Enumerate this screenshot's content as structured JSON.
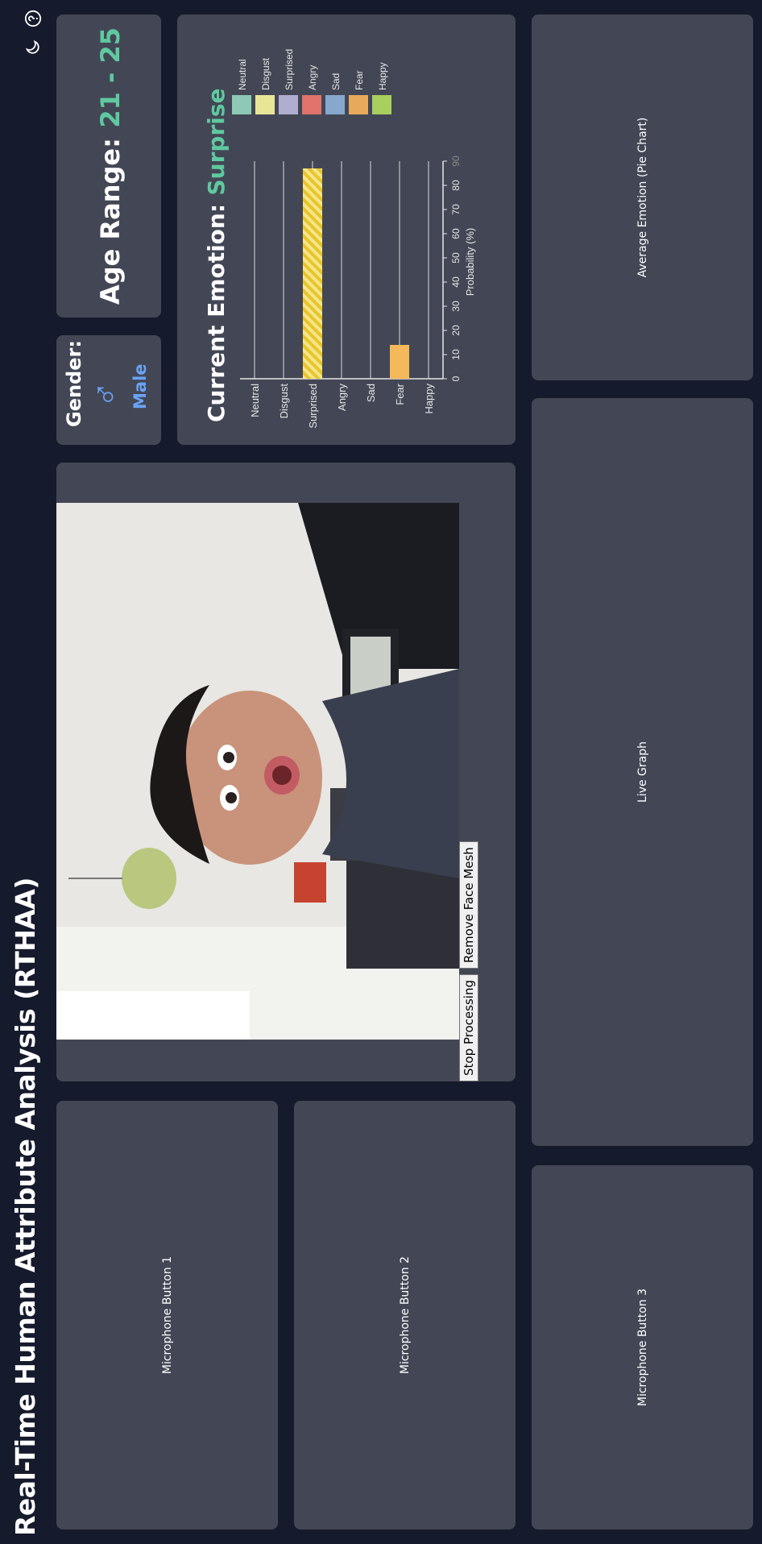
{
  "header": {
    "title": "Real-Time Human Attribute Analysis (RTHAA)",
    "icons": [
      "theme-moon-icon",
      "help-icon"
    ]
  },
  "microphones": {
    "button1": "Microphone Button 1",
    "button2": "Microphone Button 2",
    "button3": "Microphone Button 3"
  },
  "video": {
    "stop_label": "Stop Processing",
    "mesh_label": "Remove Face Mesh"
  },
  "gender": {
    "label": "Gender:",
    "symbol": "♂",
    "value": "Male"
  },
  "age": {
    "label": "Age Range:",
    "value": "21 - 25"
  },
  "emotion": {
    "label": "Current Emotion:",
    "value": "Surprise"
  },
  "panels": {
    "live_graph": "Live Graph",
    "average_emotion": "Average Emotion (Pie Chart)"
  },
  "colors": {
    "accent_green": "#5fc9a0",
    "accent_blue": "#6aa3f5"
  },
  "chart_data": {
    "type": "bar",
    "orientation": "horizontal",
    "categories": [
      "Neutral",
      "Disgust",
      "Surprised",
      "Angry",
      "Sad",
      "Fear",
      "Happy"
    ],
    "values": [
      0,
      0,
      87,
      0,
      0,
      14,
      0
    ],
    "xlabel": "Probability (%)",
    "xlim": [
      0,
      90
    ],
    "ticks": [
      "0",
      "10",
      "20",
      "30",
      "40",
      "50",
      "60",
      "70",
      "80",
      "90"
    ],
    "grid": true,
    "legend": {
      "placement": "top-right",
      "entries": [
        "Neutral",
        "Disgust",
        "Surprised",
        "Angry",
        "Sad",
        "Fear",
        "Happy"
      ],
      "colors": [
        "#8dc9b4",
        "#e8e597",
        "#b0aed0",
        "#e1736b",
        "#86a8cc",
        "#e7aa5a",
        "#a9cf5e"
      ]
    }
  }
}
